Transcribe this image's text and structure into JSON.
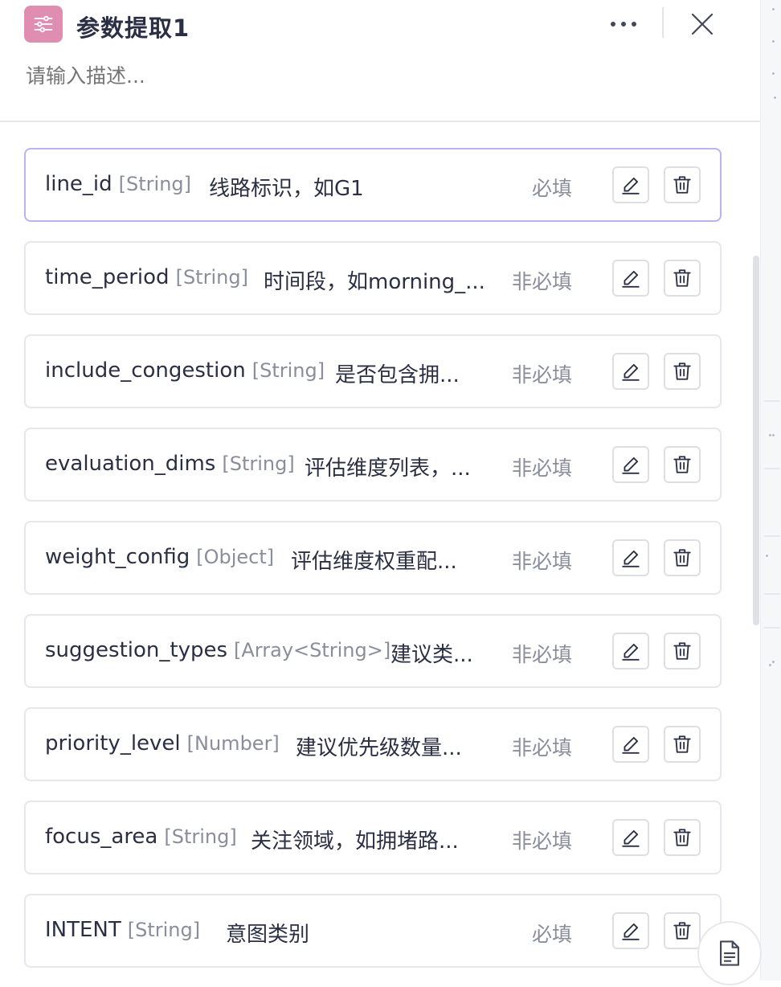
{
  "header": {
    "title": "参数提取1",
    "description_placeholder": "请输入描述...",
    "icon": "sliders-icon",
    "more_icon": "more-horizontal-icon",
    "close_icon": "close-icon"
  },
  "colors": {
    "node_icon_bg": "#e08db2",
    "selected_border": "#b9b4f0",
    "row_border": "#e6e8ee",
    "type_text": "#8a8e9c"
  },
  "params": [
    {
      "name": "line_id",
      "type": "[String]",
      "description": "线路标识，如G1",
      "required": "必填",
      "selected": true
    },
    {
      "name": "time_period",
      "type": "[String]",
      "description": "时间段，如morning_...",
      "required": "非必填"
    },
    {
      "name": "include_congestion",
      "type": "[String]",
      "description": "是否包含拥...",
      "required": "非必填"
    },
    {
      "name": "evaluation_dims",
      "type": "[String]",
      "description": "评估维度列表，...",
      "required": "非必填"
    },
    {
      "name": "weight_config",
      "type": "[Object]",
      "description": "评估维度权重配...",
      "required": "非必填"
    },
    {
      "name": "suggestion_types",
      "type": "[Array<String>]",
      "description": "建议类...",
      "required": "非必填"
    },
    {
      "name": "priority_level",
      "type": "[Number]",
      "description": "建议优先级数量...",
      "required": "非必填"
    },
    {
      "name": "focus_area",
      "type": "[String]",
      "description": "关注领域，如拥堵路...",
      "required": "非必填"
    },
    {
      "name": "INTENT",
      "type": "[String]",
      "description": "意图类别",
      "required": "必填"
    }
  ],
  "row_icons": {
    "edit": "edit-pencil-icon",
    "delete": "trash-icon"
  },
  "floating_button_icon": "document-icon"
}
